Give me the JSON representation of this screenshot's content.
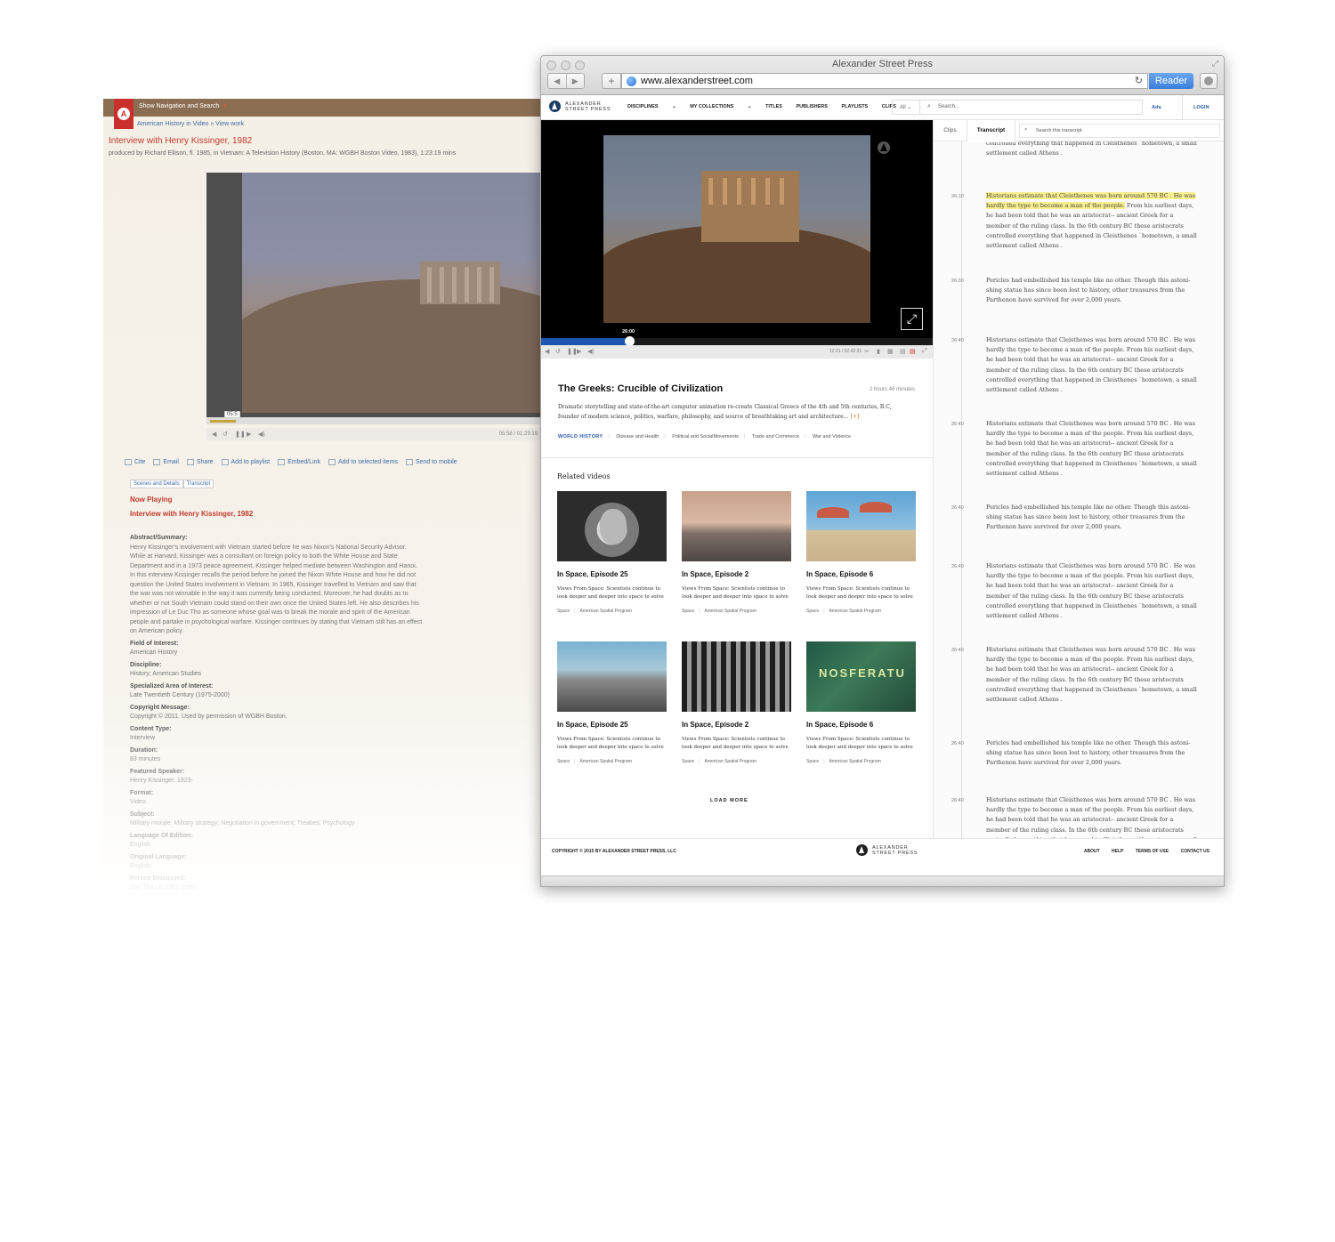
{
  "old_page": {
    "logo_text": "A",
    "nav_toggle": "Show Navigation and Search",
    "breadcrumb": "American History in Video » View work",
    "title": "Interview with Henry Kissinger, 1982",
    "subtitle": "produced by Richard Ellison, fl. 1985, in Vietnam: A Television History (Boston, MA: WGBH Boston Video, 1983), 1:23:19 mins",
    "video_time_popup": "05:5",
    "video_time": "05:58 / 01:23:19",
    "progress_fraction": 0.072,
    "actions": [
      "Cite",
      "Email",
      "Share",
      "Add to playlist",
      "Embed/Link",
      "Add to selected items",
      "Send to mobile"
    ],
    "tabs": [
      "Scenes and Details",
      "Transcript"
    ],
    "now_playing_label": "Now Playing",
    "now_playing_title": "Interview with Henry Kissinger, 1982",
    "details": [
      {
        "label": "Abstract/Summary:",
        "value": "Henry Kissinger's involvement with Vietnam started before he was Nixon's National Security Advisor. While at Harvard, Kissinger was a consultant on foreign policy to both the White House and State Department and in a 1973 peace agreement, Kissinger helped mediate between Washington and Hanoi. In this interview Kissinger recalls the period before he joined the Nixon White House and how he did not question the United States involvement in Vietnam. In 1965, Kissinger travelled to Vietnam and saw that the war was not winnable in the way it was currently being conducted. Moreover, he had doubts as to whether or not South Vietnam could stand on their own once the United States left. He also describes his impression of Le Duc Tho as someone whose goal was to break the morale and spirit of the American people and partake in psychological warfare. Kissinger continues by stating that Vietnam still has an effect on American policy."
      },
      {
        "label": "Field of Interest:",
        "value": "American History"
      },
      {
        "label": "Discipline:",
        "value": "History; American Studies"
      },
      {
        "label": "Specialized Area of Interest:",
        "value": "Late Twentieth Century (1975-2000)"
      },
      {
        "label": "Copyright Message:",
        "value": "Copyright © 2011. Used by permission of WGBH Boston."
      },
      {
        "label": "Content Type:",
        "value": "Interview"
      },
      {
        "label": "Duration:",
        "value": "83 minutes"
      },
      {
        "label": "Featured Speaker:",
        "value": "Henry Kissinger, 1923-"
      },
      {
        "label": "Format:",
        "value": "Video"
      },
      {
        "label": "Subject:",
        "value": "Military morale; Military strategy; Negotiation in government; Treaties; Psychology"
      },
      {
        "label": "Language Of Edition:",
        "value": "English"
      },
      {
        "label": "Original Language:",
        "value": "English"
      },
      {
        "label": "Person Discussed:",
        "value": "Sau Tho Le, 1911-1990"
      }
    ]
  },
  "browser": {
    "window_title": "Alexander Street Press",
    "url": "www.alexanderstreet.com",
    "reader_label": "Reader",
    "add_tab_label": "+"
  },
  "site": {
    "logo_line1": "ALEXANDER",
    "logo_line2": "STREET PRESS",
    "nav": [
      "DISCIPLINES",
      "MY COLLECTIONS",
      "TITLES",
      "PUBLISHERS",
      "PLAYLISTS",
      "CLIPS"
    ],
    "filter_value": "All",
    "search_placeholder": "Search...",
    "adv_label": "Adv.",
    "login_label": "LOGIN"
  },
  "player": {
    "current_time": "26:00",
    "timecode": "12:21 / 02:42:21",
    "progress_fraction": 0.225
  },
  "video": {
    "title": "The Greeks: Crucible of Civilization",
    "duration": "2 hours 46 minutes",
    "description": "Dramatic storytelling and state-of-the-art computer animation re-create Classical Greece of the 4th and 5th centuries, B.C, founder of modern science, politics, warfare, philosophy, and source of breathtaking art and architecture…",
    "more_label": "[+]",
    "tags": [
      "WORLD HISTORY",
      "Disease and Health",
      "Political and SocialMovements",
      "Trade and Commerce",
      "War and Violence"
    ]
  },
  "related": {
    "heading": "Related videos",
    "items": [
      {
        "title": "In Space, Episode 25",
        "desc": "Views From Space: Scientists continue to look deeper and deeper into space to solve",
        "tags": [
          "Space",
          "American Spatial Program"
        ]
      },
      {
        "title": "In Space, Episode 2",
        "desc": "Views From Space: Scientists continue to look deeper and deeper into space to solve",
        "tags": [
          "Space",
          "American Spatial Program"
        ]
      },
      {
        "title": "In Space, Episode 6",
        "desc": "Views From Space: Scientists continue to look deeper and deeper into space to solve",
        "tags": [
          "Space",
          "American Spatial Program"
        ]
      },
      {
        "title": "In Space, Episode 25",
        "desc": "Views From Space: Scientists continue to look deeper and deeper into space to solve",
        "tags": [
          "Space",
          "American Spatial Program"
        ]
      },
      {
        "title": "In Space, Episode 2",
        "desc": "Views From Space: Scientists continue to look deeper and deeper into space to solve",
        "tags": [
          "Space",
          "American Spatial Program"
        ]
      },
      {
        "title": "In Space, Episode 6",
        "desc": "Views From Space: Scientists continue to look deeper and deeper into space to solve",
        "tags": [
          "Space",
          "American Spatial Program"
        ]
      }
    ],
    "load_more": "LOAD MORE"
  },
  "transcript": {
    "tabs": [
      "Clips",
      "Transcript"
    ],
    "search_placeholder": "Search this transcript",
    "top_partial": "member of the ruling class. In the 6th century BC these aristocrats controlled everything that happened in Cleisthenes `hometown, a small settlement called Athens .",
    "entries": [
      {
        "time": "26:10",
        "highlight": "Historians estimate that Cleisthenes was born around 570 BC . He was hardly the type to become a man of the people.",
        "text": " From his earliest days, he had been told that he was an aristocrat-- ancient Greek for a member of the ruling class. In the 6th century BC these aristocrats controlled everything that happened in Cleisthenes `hometown, a small settlement called Athens ."
      },
      {
        "time": "26:30",
        "highlight": "",
        "text": "Pericles had embellished his temple like no other. Though this astoni-shing statue has since been lost to history, other treasures from the Parthenon have survived for over 2,000 years."
      },
      {
        "time": "26:40",
        "highlight": "",
        "text": "Historians estimate that Cleisthenes was born around 570 BC . He was hardly the type to become a man of the people. From his earliest days, he had been told that he was an aristocrat-- ancient Greek for a member of the ruling class. In the 6th century BC these aristocrats controlled everything that happened in Cleisthenes `hometown, a small settlement called Athens ."
      },
      {
        "time": "26:40",
        "highlight": "",
        "text": "Historians estimate that Cleisthenes was born around 570 BC . He was hardly the type to become a man of the people. From his earliest days, he had been told that he was an aristocrat-- ancient Greek for a member of the ruling class. In the 6th century BC these aristocrats controlled everything that happened in Cleisthenes `hometown, a small settlement called Athens ."
      },
      {
        "time": "26:40",
        "highlight": "",
        "text": "Pericles had embellished his temple like no other. Though this astoni-shing statue has since been lost to history, other treasures from the Parthenon have survived for over 2,000 years."
      },
      {
        "time": "26:40",
        "highlight": "",
        "text": "Historians estimate that Cleisthenes was born around 570 BC . He was hardly the type to become a man of the people. From his earliest days, he had been told that he was an aristocrat-- ancient Greek for a member of the ruling class. In the 6th century BC these aristocrats controlled everything that happened in Cleisthenes `hometown, a small settlement called Athens ."
      },
      {
        "time": "26:40",
        "highlight": "",
        "text": "Historians estimate that Cleisthenes was born around 570 BC . He was hardly the type to become a man of the people. From his earliest days, he had been told that he was an aristocrat-- ancient Greek for a member of the ruling class. In the 6th century BC these aristocrats controlled everything that happened in Cleisthenes `hometown, a small settlement called Athens ."
      },
      {
        "time": "26:40",
        "highlight": "",
        "text": "Pericles had embellished his temple like no other. Though this astoni-shing statue has since been lost to history, other treasures from the Parthenon have survived for over 2,000 years."
      },
      {
        "time": "26:40",
        "highlight": "",
        "text": "Historians estimate that Cleisthenes was born around 570 BC . He was hardly the type to become a man of the people. From his earliest days, he had been told that he was an aristocrat-- ancient Greek for a member of the ruling class. In the 6th century BC these aristocrats controlled everything that happened in Cleisthenes `hometown, a small settlement called Athens ."
      }
    ]
  },
  "footer": {
    "copyright": "COPYRIGHT © 2015 BY ALEXANDER STREET PRESS, LLC",
    "links": [
      "ABOUT",
      "HELP",
      "TERMS OF USE",
      "CONTACT US"
    ]
  }
}
